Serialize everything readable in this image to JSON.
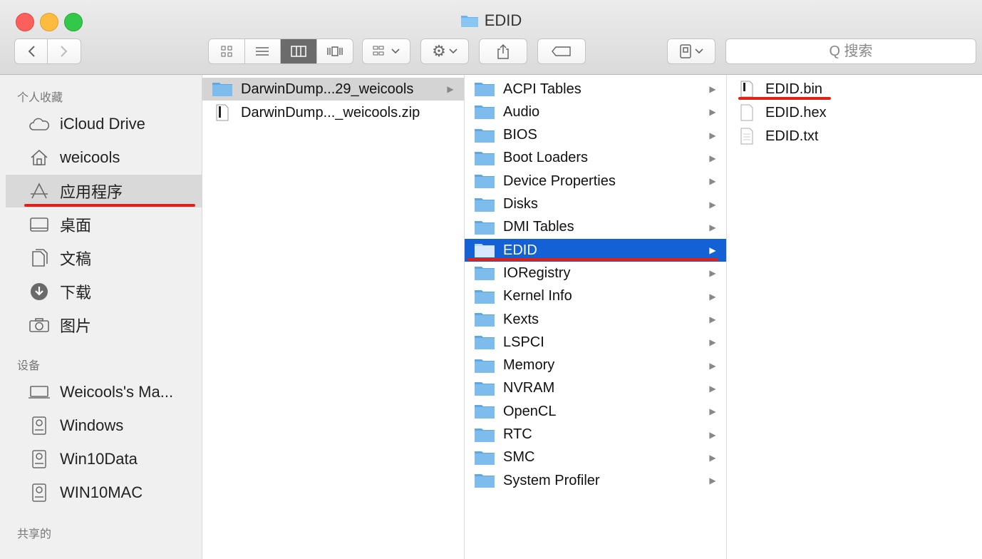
{
  "window": {
    "title": "EDID"
  },
  "toolbar": {
    "search_placeholder": "Q 搜索"
  },
  "sidebar": {
    "favorites_header": "个人收藏",
    "favorites": [
      {
        "label": "iCloud Drive",
        "icon": "cloud-icon"
      },
      {
        "label": "weicools",
        "icon": "home-icon"
      },
      {
        "label": "应用程序",
        "icon": "applications-icon"
      },
      {
        "label": "桌面",
        "icon": "desktop-icon"
      },
      {
        "label": "文稿",
        "icon": "documents-icon"
      },
      {
        "label": "下载",
        "icon": "downloads-icon"
      },
      {
        "label": "图片",
        "icon": "pictures-icon"
      }
    ],
    "devices_header": "设备",
    "devices": [
      {
        "label": "Weicools's Ma...",
        "icon": "laptop-icon"
      },
      {
        "label": "Windows",
        "icon": "disk-icon"
      },
      {
        "label": "Win10Data",
        "icon": "disk-icon"
      },
      {
        "label": "WIN10MAC",
        "icon": "disk-icon"
      }
    ],
    "shared_header": "共享的"
  },
  "column1": [
    {
      "name": "DarwinDump...29_weicools",
      "type": "folder",
      "arrow": "▶"
    },
    {
      "name": "DarwinDump..._weicools.zip",
      "type": "file"
    }
  ],
  "column2": [
    {
      "name": "ACPI Tables"
    },
    {
      "name": "Audio"
    },
    {
      "name": "BIOS"
    },
    {
      "name": "Boot Loaders"
    },
    {
      "name": "Device Properties"
    },
    {
      "name": "Disks"
    },
    {
      "name": "DMI Tables"
    },
    {
      "name": "EDID"
    },
    {
      "name": "IORegistry"
    },
    {
      "name": "Kernel Info"
    },
    {
      "name": "Kexts"
    },
    {
      "name": "LSPCI"
    },
    {
      "name": "Memory"
    },
    {
      "name": "NVRAM"
    },
    {
      "name": "OpenCL"
    },
    {
      "name": "RTC"
    },
    {
      "name": "SMC"
    },
    {
      "name": "System Profiler"
    }
  ],
  "arrow_glyph": "▶",
  "column3": [
    {
      "name": "EDID.bin",
      "type": "exec"
    },
    {
      "name": "EDID.hex",
      "type": "doc"
    },
    {
      "name": "EDID.txt",
      "type": "doc"
    }
  ],
  "colors": {
    "selection_blue": "#1460d5",
    "annotation_red": "#e0211b",
    "folder_blue": "#6cb4ea"
  }
}
